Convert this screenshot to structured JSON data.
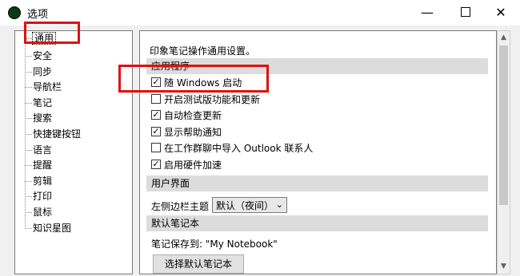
{
  "window": {
    "title": "选项",
    "minimize_glyph": "—",
    "close_glyph": "✕"
  },
  "sidebar": {
    "items": [
      {
        "label": "通用",
        "selected": true
      },
      {
        "label": "安全"
      },
      {
        "label": "同步"
      },
      {
        "label": "导航栏"
      },
      {
        "label": "笔记"
      },
      {
        "label": "搜索"
      },
      {
        "label": "快捷键按钮"
      },
      {
        "label": "语言"
      },
      {
        "label": "提醒"
      },
      {
        "label": "剪辑"
      },
      {
        "label": "打印"
      },
      {
        "label": "鼠标"
      },
      {
        "label": "知识星图"
      }
    ]
  },
  "panel": {
    "intro": "印象笔记操作通用设置。",
    "sections": {
      "app": "应用程序",
      "ui": "用户界面",
      "notebook": "默认笔记本"
    },
    "checkboxes": [
      {
        "label": "随 Windows 启动",
        "checked": true
      },
      {
        "label": "开启测试版功能和更新",
        "checked": false
      },
      {
        "label": "自动检查更新",
        "checked": true
      },
      {
        "label": "显示帮助通知",
        "checked": true
      },
      {
        "label": "在工作群聊中导入 Outlook 联系人",
        "checked": false
      },
      {
        "label": "启用硬件加速",
        "checked": true
      }
    ],
    "sidebar_theme_label": "左侧边栏主题",
    "sidebar_theme_value": "默认（夜间）",
    "notebook_save_text": "笔记保存到: \"My Notebook\"",
    "choose_notebook_button": "选择默认笔记本"
  },
  "highlight_color": "#e01010"
}
